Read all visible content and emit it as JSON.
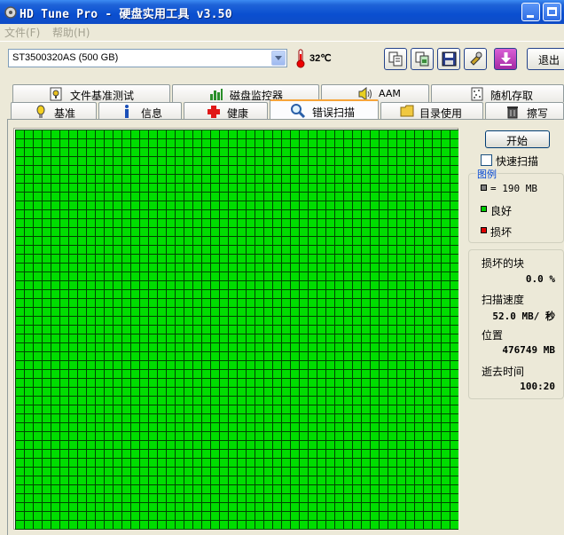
{
  "window": {
    "title": "HD Tune Pro - 硬盘实用工具 v3.50"
  },
  "menu": {
    "items": [
      "文件(F)",
      "帮助(H)"
    ]
  },
  "toolbar": {
    "drive": "ST3500320AS (500 GB)",
    "temperature": "32℃",
    "exit_label": "退出"
  },
  "tabs": {
    "row1": [
      "文件基准测试",
      "磁盘监控器",
      "AAM",
      "随机存取"
    ],
    "row2": [
      "基准",
      "信息",
      "健康",
      "错误扫描",
      "目录使用",
      "擦写"
    ],
    "active": "错误扫描"
  },
  "scan": {
    "start_label": "开始",
    "quick_scan_label": "快速扫描",
    "quick_scan_checked": false,
    "block_status": "good",
    "colors": {
      "good": "#00dd00",
      "damaged": "#e00000",
      "legend_gray": "#808080"
    }
  },
  "legend": {
    "title": "图例",
    "block_size": "= 190 MB",
    "good": "良好",
    "damaged": "损坏"
  },
  "stats": {
    "damaged_blocks_label": "损坏的块",
    "damaged_blocks_value": "0.0 %",
    "scan_speed_label": "扫描速度",
    "scan_speed_value": "52.0 MB/ 秒",
    "position_label": "位置",
    "position_value": "476749 MB",
    "elapsed_label": "逝去时间",
    "elapsed_value": "100:20"
  }
}
